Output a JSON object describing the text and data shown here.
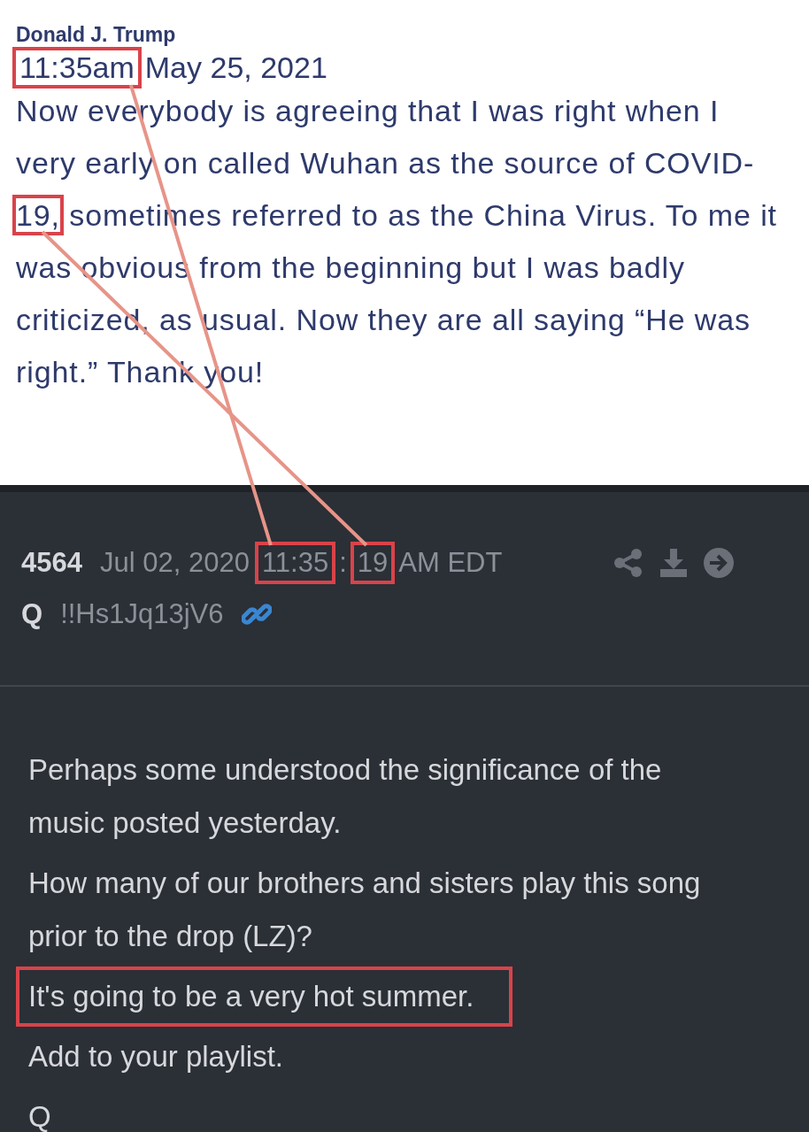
{
  "post": {
    "author": "Donald J. Trump",
    "time": {
      "text": "11:35am",
      "marked": true
    },
    "date": "May 25, 2021",
    "body": [
      {
        "text": "Now everybody is agreeing that I was right when I very early on called Wuhan as the source of COVID-",
        "marked": false
      },
      {
        "text": "19,",
        "marked": true
      },
      {
        "text": " sometimes referred to as the China Virus. To me it was obvious from the beginning but I was badly criticized, as usual. Now they are all saying “He was right.” Thank you!",
        "marked": false
      }
    ]
  },
  "drop": {
    "number": "4564",
    "date": "Jul 02, 2020",
    "time": [
      {
        "text": "11:35",
        "marked": true
      },
      {
        "text": ":",
        "marked": false
      },
      {
        "text": "19",
        "marked": true
      },
      {
        "text": " AM EDT",
        "marked": false
      }
    ],
    "author": "Q",
    "tripcode": "!!Hs1Jq13jV6",
    "lines": [
      {
        "text": "Perhaps some understood the significance of the music posted yesterday.",
        "marked": false
      },
      {
        "text": "How many of our brothers and sisters play this song prior to the drop (LZ)?",
        "marked": false
      },
      {
        "text": "It's going to be a very hot summer.",
        "marked": true
      },
      {
        "text": "Add to your playlist.",
        "marked": false
      },
      {
        "text": "Q",
        "marked": false
      }
    ]
  }
}
